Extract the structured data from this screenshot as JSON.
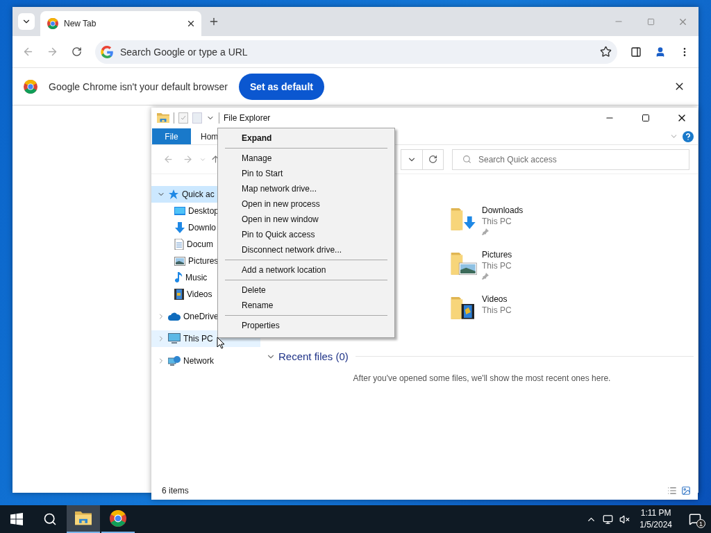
{
  "browser": {
    "tabs": [
      {
        "title": "New Tab",
        "selected": true
      }
    ],
    "omnibox": {
      "placeholder": "Search Google or type a URL"
    },
    "infobar": {
      "message": "Google Chrome isn't your default browser",
      "button": "Set as default"
    }
  },
  "explorer": {
    "title": "File Explorer",
    "ribbon_tabs": [
      {
        "label": "File",
        "kind": "file"
      },
      {
        "label": "Hom",
        "kind": "tab"
      }
    ],
    "search": {
      "placeholder": "Search Quick access"
    },
    "nav": [
      {
        "label": "Quick ac",
        "expanded": true,
        "selected": true,
        "hovered": false,
        "children": [
          {
            "label": "Desktop"
          },
          {
            "label": "Downlo"
          },
          {
            "label": "Docum"
          },
          {
            "label": "Pictures"
          },
          {
            "label": "Music"
          },
          {
            "label": "Videos"
          }
        ]
      },
      {
        "label": "OneDrive",
        "expanded": false,
        "selected": false,
        "hovered": false
      },
      {
        "label": "This PC",
        "expanded": false,
        "selected": false,
        "hovered": true
      },
      {
        "label": "Network",
        "expanded": false,
        "selected": false,
        "hovered": false
      }
    ],
    "folders": [
      {
        "name": "Downloads",
        "location": "This PC",
        "pinned": true
      },
      {
        "name": "Pictures",
        "location": "This PC",
        "pinned": true
      },
      {
        "name": "Videos",
        "location": "This PC",
        "pinned": false
      }
    ],
    "recent": {
      "title": "Recent files (0)",
      "expanded": true,
      "message": "After you've opened some files, we'll show the most recent ones here."
    },
    "status": "6 items"
  },
  "context_menu": [
    {
      "kind": "item",
      "label": "Expand",
      "default": true
    },
    {
      "kind": "separator"
    },
    {
      "kind": "item",
      "label": "Manage",
      "default": false
    },
    {
      "kind": "item",
      "label": "Pin to Start",
      "default": false
    },
    {
      "kind": "item",
      "label": "Map network drive...",
      "default": false
    },
    {
      "kind": "item",
      "label": "Open in new process",
      "default": false
    },
    {
      "kind": "item",
      "label": "Open in new window",
      "default": false
    },
    {
      "kind": "item",
      "label": "Pin to Quick access",
      "default": false
    },
    {
      "kind": "item",
      "label": "Disconnect network drive...",
      "default": false
    },
    {
      "kind": "separator"
    },
    {
      "kind": "item",
      "label": "Add a network location",
      "default": false
    },
    {
      "kind": "separator"
    },
    {
      "kind": "item",
      "label": "Delete",
      "default": false
    },
    {
      "kind": "item",
      "label": "Rename",
      "default": false
    },
    {
      "kind": "separator"
    },
    {
      "kind": "item",
      "label": "Properties",
      "default": false
    }
  ],
  "taskbar": {
    "apps": [
      {
        "kind": "explorer",
        "active": true,
        "running": true
      },
      {
        "kind": "chrome",
        "active": false,
        "running": true
      }
    ],
    "time": "1:11 PM",
    "date": "1/5/2024",
    "notifications": "1"
  }
}
